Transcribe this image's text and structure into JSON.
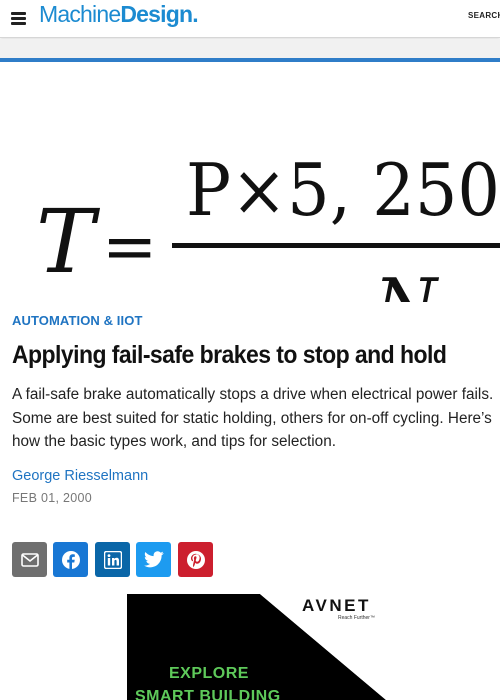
{
  "header": {
    "logo_part1": "Machine",
    "logo_part2": "Design.",
    "search_label": "SEARCH",
    "brand_color": "#1c8bd1"
  },
  "hero": {
    "formula_lhs": "T",
    "formula_equals": "=",
    "numerator": "P×5, 250",
    "denominator": "N"
  },
  "article": {
    "category": "AUTOMATION & IIOT",
    "headline": "Applying fail-safe brakes to stop and hold",
    "dek": "A fail-safe brake automatically stops a drive when electrical power fails. Some are best suited for static holding, others for on-off cycling. Here’s how the basic types work, and tips for selection.",
    "author": "George Riesselmann",
    "date": "FEB 01, 2000"
  },
  "share": {
    "icons": [
      "email-icon",
      "facebook-icon",
      "linkedin-icon",
      "twitter-icon",
      "pinterest-icon"
    ],
    "colors": {
      "email": "#6f6f6f",
      "facebook": "#1877d4",
      "linkedin": "#0a66a8",
      "twitter": "#1d9bf0",
      "pinterest": "#cc1f2e"
    }
  },
  "ad": {
    "brand": "AVNET",
    "tagline": "Reach Further™",
    "line1": "EXPLORE",
    "line2": "SMART BUILDING",
    "accent_color": "#5ec95a"
  }
}
